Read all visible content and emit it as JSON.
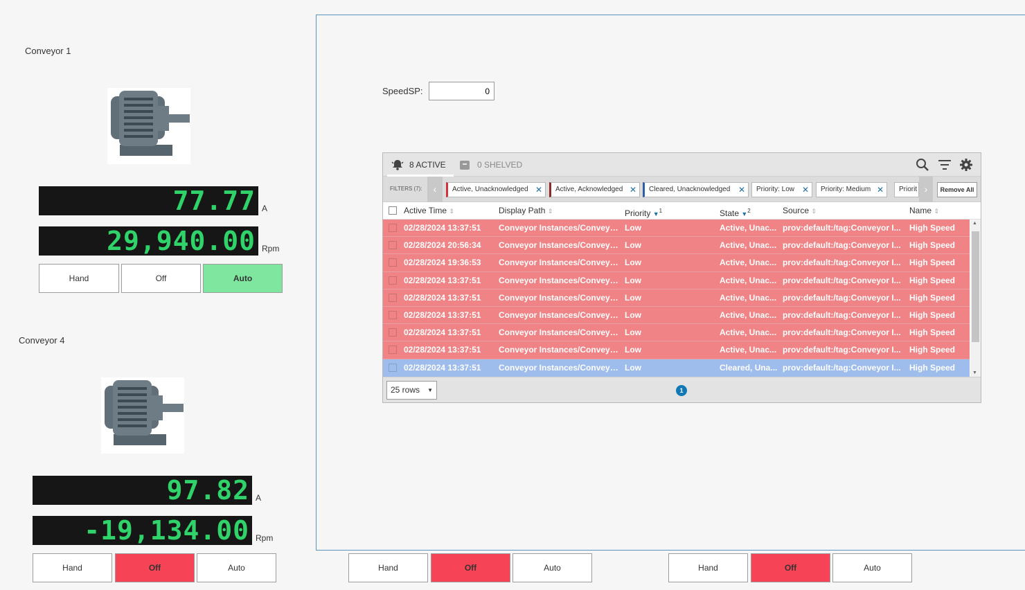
{
  "conveyor1": {
    "title": "Conveyor 1",
    "current_display": "77.77",
    "current_unit": "A",
    "speed_display": "29,940.00",
    "speed_unit": "Rpm",
    "buttons": {
      "hand": "Hand",
      "off": "Off",
      "auto": "Auto"
    },
    "mode": "Auto"
  },
  "conveyor4": {
    "title": "Conveyor 4",
    "current_display": "97.82",
    "current_unit": "A",
    "speed_display": "-19,134.00",
    "speed_unit": "Rpm",
    "buttons": {
      "hand": "Hand",
      "off": "Off",
      "auto": "Auto"
    },
    "mode": "Off"
  },
  "bottom_controls": [
    {
      "buttons": {
        "hand": "Hand",
        "off": "Off",
        "auto": "Auto"
      },
      "mode": "Off"
    },
    {
      "buttons": {
        "hand": "Hand",
        "off": "Off",
        "auto": "Auto"
      },
      "mode": "Off"
    }
  ],
  "speed_sp": {
    "label": "SpeedSP:",
    "value": "0"
  },
  "alarm_table": {
    "tabs": {
      "active": "8 ACTIVE",
      "shelved": "0 SHELVED"
    },
    "filters_label": "FILTERS (7):",
    "filters": [
      {
        "label": "Active, Unacknowledged",
        "color": "#d0323c"
      },
      {
        "label": "Active, Acknowledged",
        "color": "#8a2a2a"
      },
      {
        "label": "Cleared, Unacknowledged",
        "color": "#2b5ea8"
      },
      {
        "label": "Priority: Low",
        "color": ""
      },
      {
        "label": "Priority: Medium",
        "color": ""
      },
      {
        "label": "Priorit",
        "color": ""
      }
    ],
    "remove_all": "Remove All",
    "columns": {
      "active_time": "Active Time",
      "display_path": "Display Path",
      "priority": "Priority",
      "priority_sort": "1",
      "state": "State",
      "state_sort": "2",
      "source": "Source",
      "name": "Name"
    },
    "rows": [
      {
        "time": "02/28/2024 13:37:51",
        "path": "Conveyor Instances/Conveyo...",
        "priority": "Low",
        "state": "Active, Unac...",
        "source": "prov:default:/tag:Conveyor I...",
        "name": "High Speed",
        "status": "active"
      },
      {
        "time": "02/28/2024 20:56:34",
        "path": "Conveyor Instances/Conveyo...",
        "priority": "Low",
        "state": "Active, Unac...",
        "source": "prov:default:/tag:Conveyor I...",
        "name": "High Speed",
        "status": "active"
      },
      {
        "time": "02/28/2024 19:36:53",
        "path": "Conveyor Instances/Conveyo...",
        "priority": "Low",
        "state": "Active, Unac...",
        "source": "prov:default:/tag:Conveyor I...",
        "name": "High Speed",
        "status": "active"
      },
      {
        "time": "02/28/2024 13:37:51",
        "path": "Conveyor Instances/Conveyo...",
        "priority": "Low",
        "state": "Active, Unac...",
        "source": "prov:default:/tag:Conveyor I...",
        "name": "High Speed",
        "status": "active"
      },
      {
        "time": "02/28/2024 13:37:51",
        "path": "Conveyor Instances/Conveyo...",
        "priority": "Low",
        "state": "Active, Unac...",
        "source": "prov:default:/tag:Conveyor I...",
        "name": "High Speed",
        "status": "active"
      },
      {
        "time": "02/28/2024 13:37:51",
        "path": "Conveyor Instances/Conveyo...",
        "priority": "Low",
        "state": "Active, Unac...",
        "source": "prov:default:/tag:Conveyor I...",
        "name": "High Speed",
        "status": "active"
      },
      {
        "time": "02/28/2024 13:37:51",
        "path": "Conveyor Instances/Conveyo...",
        "priority": "Low",
        "state": "Active, Unac...",
        "source": "prov:default:/tag:Conveyor I...",
        "name": "High Speed",
        "status": "active"
      },
      {
        "time": "02/28/2024 13:37:51",
        "path": "Conveyor Instances/Conveyo...",
        "priority": "Low",
        "state": "Active, Unac...",
        "source": "prov:default:/tag:Conveyor I...",
        "name": "High Speed",
        "status": "active"
      },
      {
        "time": "02/28/2024 13:37:51",
        "path": "Conveyor Instances/Conveyo...",
        "priority": "Low",
        "state": "Cleared, Una...",
        "source": "prov:default:/tag:Conveyor I...",
        "name": "High Speed",
        "status": "cleared"
      }
    ],
    "rows_per_page": "25 rows",
    "current_page": "1"
  },
  "colors": {
    "active_row": "#f08385",
    "cleared_row": "#9ebcec",
    "auto_on": "#7fe6a0",
    "off_on": "#f64456",
    "lcd_text": "#2fd36a",
    "frame_border": "#5a93bd"
  },
  "icons": [
    "motor-icon",
    "alarm-bell-icon",
    "shelve-icon",
    "search-icon",
    "filter-icon",
    "gear-icon",
    "chevron-left-icon",
    "chevron-right-icon",
    "close-icon",
    "sort-icon",
    "dropdown-arrow-icon"
  ]
}
